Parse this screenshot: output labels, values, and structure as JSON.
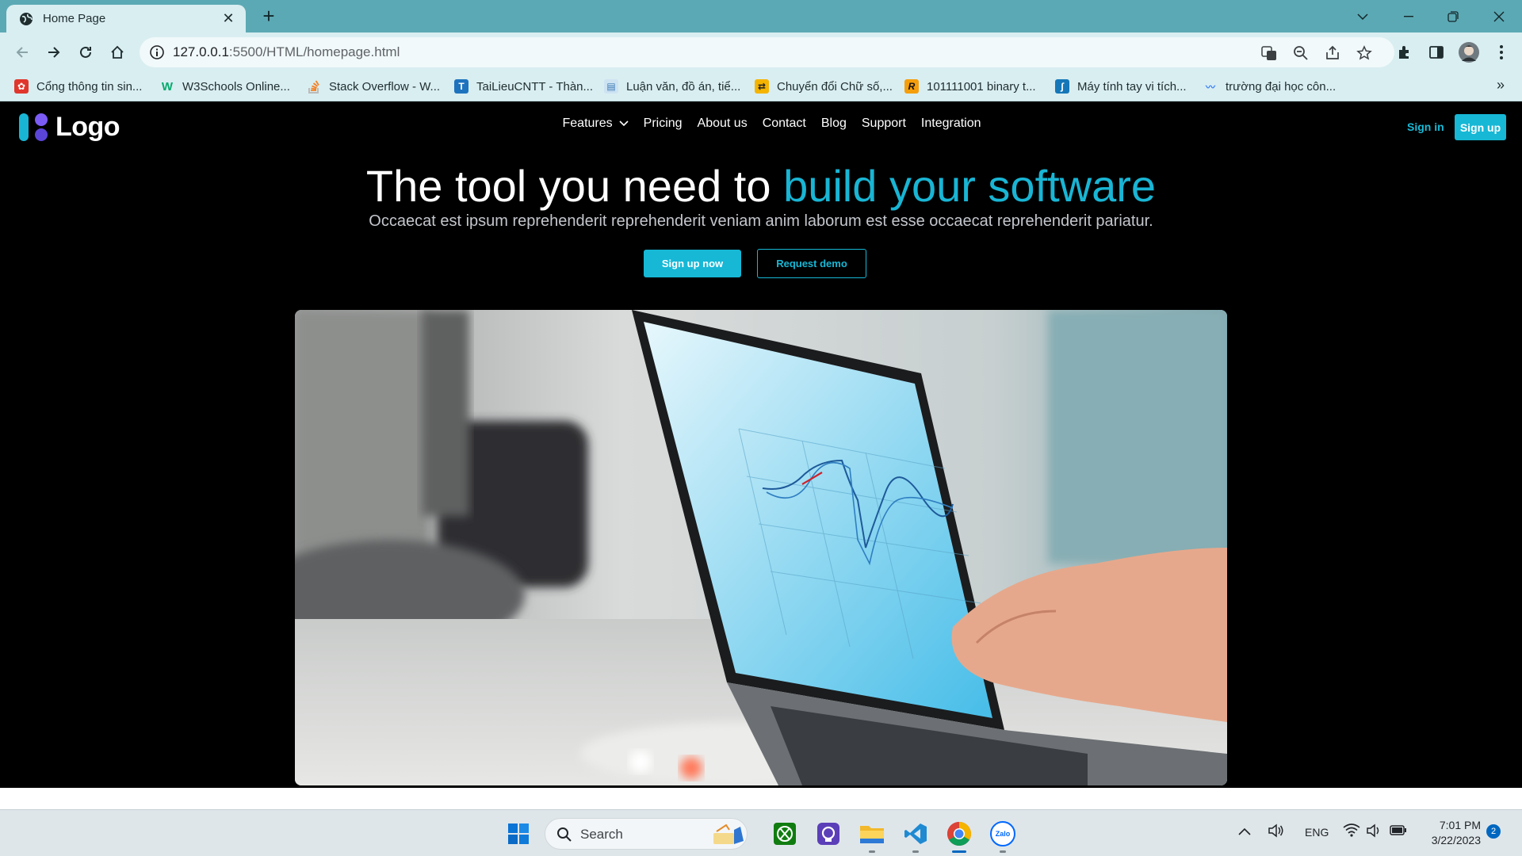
{
  "browser": {
    "tab": {
      "title": "Home Page",
      "close": "✕"
    },
    "new_tab": "+",
    "address": {
      "host": "127.0.0.1",
      "path": ":5500/HTML/homepage.html"
    },
    "bookmarks": [
      {
        "label": "Cổng thông tin sin...",
        "color": "#e0362c"
      },
      {
        "label": "W3Schools Online...",
        "color": "#04aa6d"
      },
      {
        "label": "Stack Overflow - W...",
        "color": "#f48024"
      },
      {
        "label": "TaiLieuCNTT - Thàn...",
        "color": "#1e73be"
      },
      {
        "label": "Luận văn, đồ án, tiể...",
        "color": "#5aa0d8"
      },
      {
        "label": "Chuyển đổi Chữ số,...",
        "color": "#f5b400"
      },
      {
        "label": "101111001 binary t...",
        "color": "#f59e0b"
      },
      {
        "label": "Máy tính tay vi tích...",
        "color": "#1577b8"
      },
      {
        "label": "trường đại học côn...",
        "color": "#3b82f6"
      }
    ],
    "bookmarks_more": "»"
  },
  "site": {
    "logo_text": "Logo",
    "nav": [
      "Features",
      "Pricing",
      "About us",
      "Contact",
      "Blog",
      "Support",
      "Integration"
    ],
    "signin": "Sign in",
    "signup": "Sign up",
    "hero": {
      "title_plain": "The tool you need to ",
      "title_accent": "build your software",
      "subtitle": "Occaecat est ipsum reprehenderit reprehenderit veniam anim laborum est esse occaecat reprehenderit pariatur.",
      "primary_button": "Sign up now",
      "secondary_button": "Request demo"
    },
    "colors": {
      "accent": "#16b8d6",
      "background": "#000000"
    }
  },
  "taskbar": {
    "search_placeholder": "Search",
    "language": "ENG",
    "time": "7:01 PM",
    "date": "3/22/2023",
    "notifications": "2"
  }
}
